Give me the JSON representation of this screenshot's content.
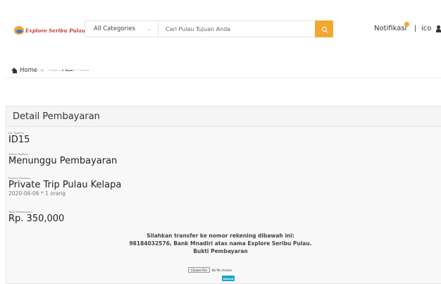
{
  "header": {
    "logo_text": "Explore Seribu Pulau",
    "category_selected": "All Categories",
    "search_placeholder": "Cari Pulau Tujuan Anda",
    "notif_label": "Notifikasi",
    "separator": "|",
    "user_label": "ico"
  },
  "breadcrumb": {
    "home": "Home",
    "separator": ">",
    "step1": "1. Pesan",
    "step2": "2. Bayar",
    "step3": "3. Selesai",
    "step_sep": ">"
  },
  "payment": {
    "title": "Detail Pembayaran",
    "invoice_no_label": "No. Tagihan",
    "invoice_no": "ID15",
    "status_label": "Status Tagihan",
    "status": "Menunggu Pembayaran",
    "order_summary_label": "Rincian Pesanan",
    "order_name": "Private Trip Pulau Kelapa",
    "order_detail": "2020-06-06 * 1 orang",
    "total_label": "Total Pembayaran",
    "total": "Rp. 350,000",
    "instruction_1": "Silahkan transfer ke nomor rekening dibawah ini:",
    "instruction_2": "98184032576, Bank Mnadiri atas nama Explore Seribu Pulau.",
    "proof_label": "Bukti Pembayaran",
    "file_button": "Choose File",
    "file_status": "No file chosen",
    "upload_button": "Upload"
  },
  "colors": {
    "accent": "#f0a830",
    "upload": "#1aa5c8",
    "logo": "#c0392b"
  },
  "icons": {
    "search": "search-icon",
    "home": "home-icon",
    "user": "user-icon",
    "dropdown": "chevron-down-icon"
  }
}
